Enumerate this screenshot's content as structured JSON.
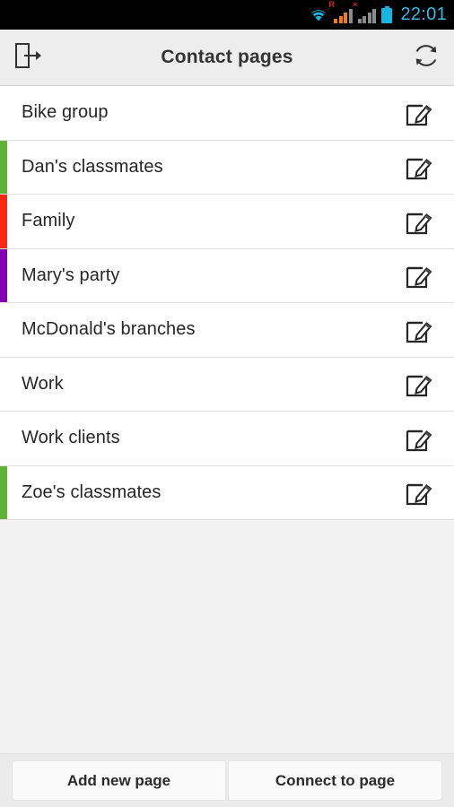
{
  "status_bar": {
    "time": "22:01",
    "icons": [
      {
        "name": "wifi-icon",
        "label": "wifi",
        "color": "#19b5e0"
      },
      {
        "name": "cellular-signal-roaming-icon",
        "label": "R",
        "color": "#f07c1e",
        "badge": "R",
        "badge_color": "#d42a1e",
        "bars_on": 3
      },
      {
        "name": "cellular-signal-no-service-icon",
        "label": "x",
        "color": "#8c8c8c",
        "badge": "×",
        "badge_color": "#d42a1e",
        "bars_on": 0
      },
      {
        "name": "battery-icon",
        "label": "battery",
        "color": "#19b5e0"
      }
    ]
  },
  "header": {
    "title": "Contact pages",
    "logout_icon": "logout-icon",
    "refresh_icon": "refresh-icon"
  },
  "list": {
    "edit_icon": "edit-icon",
    "rows": [
      {
        "label": "Bike group",
        "color": ""
      },
      {
        "label": "Dan's classmates",
        "color": "#5fb236"
      },
      {
        "label": "Family",
        "color": "#f82a14"
      },
      {
        "label": "Mary's party",
        "color": "#8000b0"
      },
      {
        "label": "McDonald's branches",
        "color": ""
      },
      {
        "label": "Work",
        "color": ""
      },
      {
        "label": "Work clients",
        "color": ""
      },
      {
        "label": "Zoe's classmates",
        "color": "#5fb236"
      }
    ]
  },
  "bottom_bar": {
    "add_label": "Add new page",
    "connect_label": "Connect to page"
  }
}
